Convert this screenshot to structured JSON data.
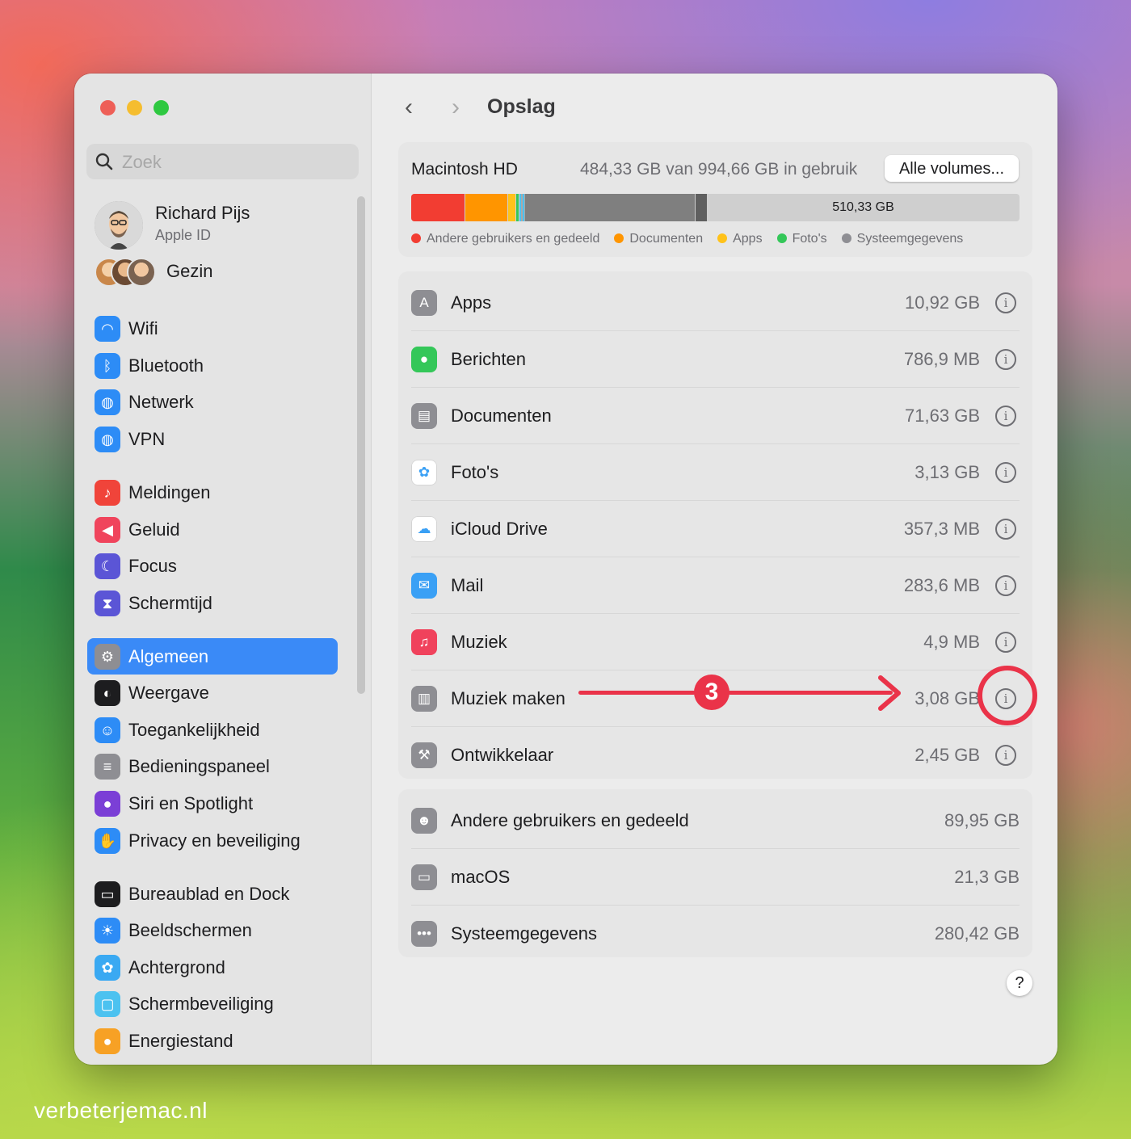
{
  "window": {
    "page_title": "Opslag"
  },
  "sidebar": {
    "search_placeholder": "Zoek",
    "profile": {
      "name": "Richard Pijs",
      "subtitle": "Apple ID"
    },
    "family_label": "Gezin",
    "items": [
      {
        "label": "Wifi",
        "icon": "wifi-icon",
        "color": "#2d8cf6"
      },
      {
        "label": "Bluetooth",
        "icon": "bluetooth-icon",
        "color": "#2d8cf6"
      },
      {
        "label": "Netwerk",
        "icon": "globe-icon",
        "color": "#2d8cf6"
      },
      {
        "label": "VPN",
        "icon": "vpn-globe-icon",
        "color": "#2d8cf6"
      },
      {
        "label": "Meldingen",
        "icon": "bell-icon",
        "color": "#f0443a"
      },
      {
        "label": "Geluid",
        "icon": "speaker-icon",
        "color": "#f0445c"
      },
      {
        "label": "Focus",
        "icon": "moon-icon",
        "color": "#5b55d6"
      },
      {
        "label": "Schermtijd",
        "icon": "hourglass-icon",
        "color": "#5b55d6"
      },
      {
        "label": "Algemeen",
        "icon": "gear-icon",
        "color": "#8e8e93"
      },
      {
        "label": "Weergave",
        "icon": "appearance-icon",
        "color": "#1d1d1f"
      },
      {
        "label": "Toegankelijkheid",
        "icon": "accessibility-icon",
        "color": "#2d8cf6"
      },
      {
        "label": "Bedieningspaneel",
        "icon": "control-center-icon",
        "color": "#8e8e93"
      },
      {
        "label": "Siri en Spotlight",
        "icon": "siri-icon",
        "color": "#7b3fd6"
      },
      {
        "label": "Privacy en beveiliging",
        "icon": "hand-icon",
        "color": "#2d8cf6"
      },
      {
        "label": "Bureaublad en Dock",
        "icon": "dock-icon",
        "color": "#1d1d1f"
      },
      {
        "label": "Beeldschermen",
        "icon": "sun-icon",
        "color": "#2d8cf6"
      },
      {
        "label": "Achtergrond",
        "icon": "flower-icon",
        "color": "#3aa9f2"
      },
      {
        "label": "Schermbeveiliging",
        "icon": "screensaver-icon",
        "color": "#4cc2f0"
      },
      {
        "label": "Energiestand",
        "icon": "bulb-icon",
        "color": "#f7a125"
      }
    ],
    "selected": "Algemeen"
  },
  "storage": {
    "disk_name": "Macintosh HD",
    "usage_text": "484,33 GB van 994,66 GB in gebruik",
    "volumes_button": "Alle volumes...",
    "free_label": "510,33 GB",
    "legend": [
      {
        "label": "Andere gebruikers en gedeeld",
        "color": "#f23d32"
      },
      {
        "label": "Documenten",
        "color": "#ff9500"
      },
      {
        "label": "Apps",
        "color": "#ffc21a"
      },
      {
        "label": "Foto's",
        "color": "#34c759"
      },
      {
        "label": "Systeemgegevens",
        "color": "#8e8e93"
      }
    ],
    "apps": [
      {
        "name": "Apps",
        "size": "10,92 GB",
        "icon": "app-store-icon",
        "color": "#8e8e93"
      },
      {
        "name": "Berichten",
        "size": "786,9 MB",
        "icon": "messages-icon",
        "color": "#34c759"
      },
      {
        "name": "Documenten",
        "size": "71,63 GB",
        "icon": "document-icon",
        "color": "#8e8e93"
      },
      {
        "name": "Foto's",
        "size": "3,13 GB",
        "icon": "photos-icon",
        "color": "#ffffff"
      },
      {
        "name": "iCloud Drive",
        "size": "357,3 MB",
        "icon": "cloud-icon",
        "color": "#ffffff"
      },
      {
        "name": "Mail",
        "size": "283,6 MB",
        "icon": "mail-icon",
        "color": "#3aa0f5"
      },
      {
        "name": "Muziek",
        "size": "4,9 MB",
        "icon": "music-icon",
        "color": "#f0425c"
      },
      {
        "name": "Muziek maken",
        "size": "3,08 GB",
        "icon": "music-creation-icon",
        "color": "#8e8e93"
      },
      {
        "name": "Ontwikkelaar",
        "size": "2,45 GB",
        "icon": "hammer-icon",
        "color": "#8e8e93"
      }
    ],
    "system": [
      {
        "name": "Andere gebruikers en gedeeld",
        "size": "89,95 GB",
        "icon": "users-icon",
        "color": "#8e8e93"
      },
      {
        "name": "macOS",
        "size": "21,3 GB",
        "icon": "drive-icon",
        "color": "#8e8e93"
      },
      {
        "name": "Systeemgegevens",
        "size": "280,42 GB",
        "icon": "ellipsis-icon",
        "color": "#8e8e93"
      }
    ],
    "help_label": "?"
  },
  "annotation": {
    "step": "3",
    "color": "#ea3349"
  },
  "watermark": "verbeterjemac.nl"
}
